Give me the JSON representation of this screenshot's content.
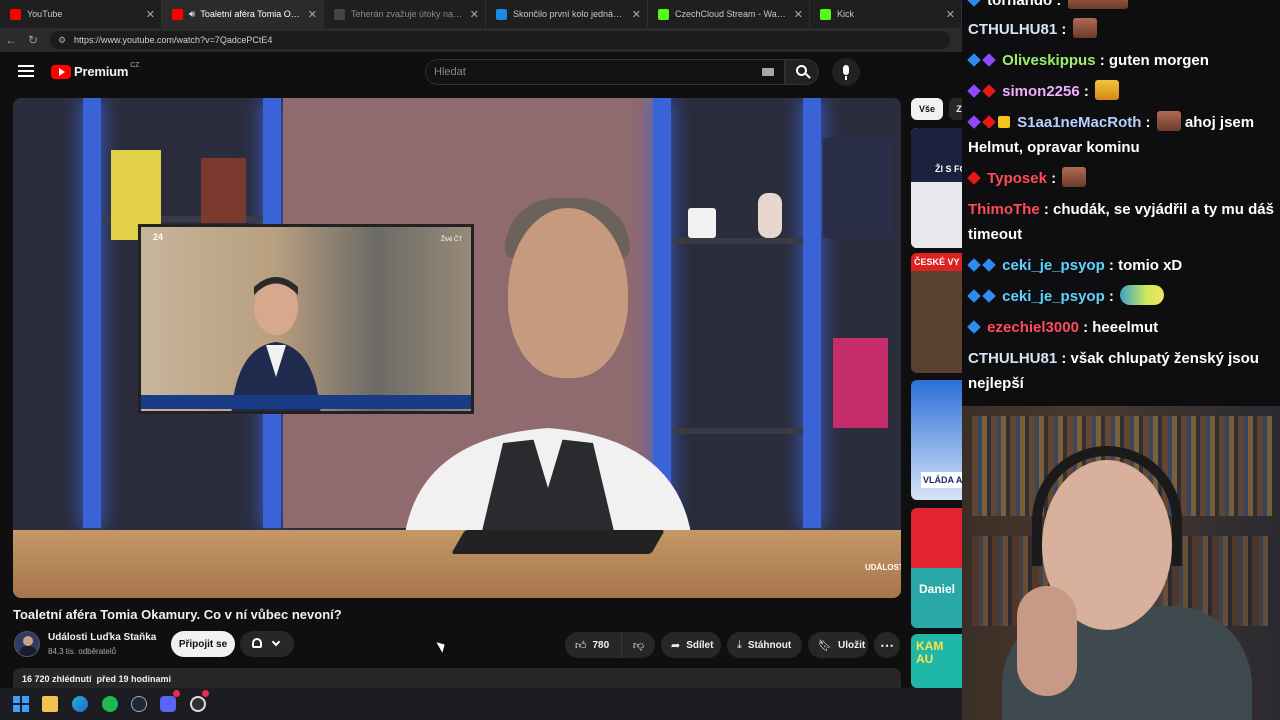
{
  "browser": {
    "tabs": [
      {
        "title": "YouTube",
        "favicon": "youtube-icon",
        "active": false
      },
      {
        "title": "Toaletní aféra Tomia Okamury",
        "favicon": "youtube-icon",
        "active": true,
        "audio": true
      },
      {
        "title": "Teherán zvažuje útoky na vojensk",
        "favicon": "news-icon",
        "active": false
      },
      {
        "title": "Skončilo první kolo jednání minist",
        "favicon": "news-icon",
        "active": false
      },
      {
        "title": "CzechCloud Stream - Watch Live o",
        "favicon": "kick-icon",
        "active": false
      },
      {
        "title": "Kick",
        "favicon": "kick-icon",
        "active": false
      }
    ],
    "url": "https://www.youtube.com/watch?v=7QadcePCtE4"
  },
  "youtube": {
    "brand": "Premium",
    "country": "CZ",
    "search_placeholder": "Hledat",
    "video": {
      "title": "Toaletní aféra Tomia Okamury. Co v ní vůbec nevoní?",
      "watermark": "UDÁLOSTI",
      "tv_channel": "24",
      "tv_live": "Živě ČT"
    },
    "channel": {
      "name": "Události Luďka Staňka",
      "subscribers": "84,3 tis. odběratelů"
    },
    "actions": {
      "join": "Připojit se",
      "likes": "780",
      "share": "Sdílet",
      "download": "Stáhnout",
      "save": "Uložit"
    },
    "description": {
      "views": "16 720 zhlédnutí",
      "age": "před 19 hodinami"
    },
    "chips": {
      "all": "Vše",
      "second": "Z"
    },
    "recommended": [
      {
        "caption": "ŽI S FO"
      },
      {
        "caption": "ČESKÉ VY"
      },
      {
        "caption": "VLÁDA A"
      },
      {
        "caption": "Daniel"
      },
      {
        "caption": "KAM AU"
      }
    ]
  },
  "chat": {
    "messages": [
      {
        "user": "tornando",
        "user_color": "#ffffff",
        "text": ""
      },
      {
        "user": "CTHULHU81",
        "user_color": "#d6e4f5",
        "text": ""
      },
      {
        "user": "Oliveskippus",
        "user_color": "#9bf06b",
        "text": "guten morgen"
      },
      {
        "user": "simon2256",
        "user_color": "#f0b0ff",
        "text": ""
      },
      {
        "user": "S1aa1neMacRoth",
        "user_color": "#b8d0ff",
        "text": "ahoj jsem Helmut, opravar kominu"
      },
      {
        "user": "Typosek",
        "user_color": "#ff4b5a",
        "text": ""
      },
      {
        "user": "ThimoThe",
        "user_color": "#ff4b5a",
        "text": "chudák, se vyjádřil a ty mu dáš timeout"
      },
      {
        "user": "ceki_je_psyop",
        "user_color": "#5fd3ff",
        "text": "tomio xD"
      },
      {
        "user": "ceki_je_psyop",
        "user_color": "#5fd3ff",
        "text": ""
      },
      {
        "user": "ezechiel3000",
        "user_color": "#ff4b5a",
        "text": "heeelmut"
      },
      {
        "user": "CTHULHU81",
        "user_color": "#d6e4f5",
        "text": "však chlupatý ženský jsou nejlepší"
      }
    ]
  }
}
